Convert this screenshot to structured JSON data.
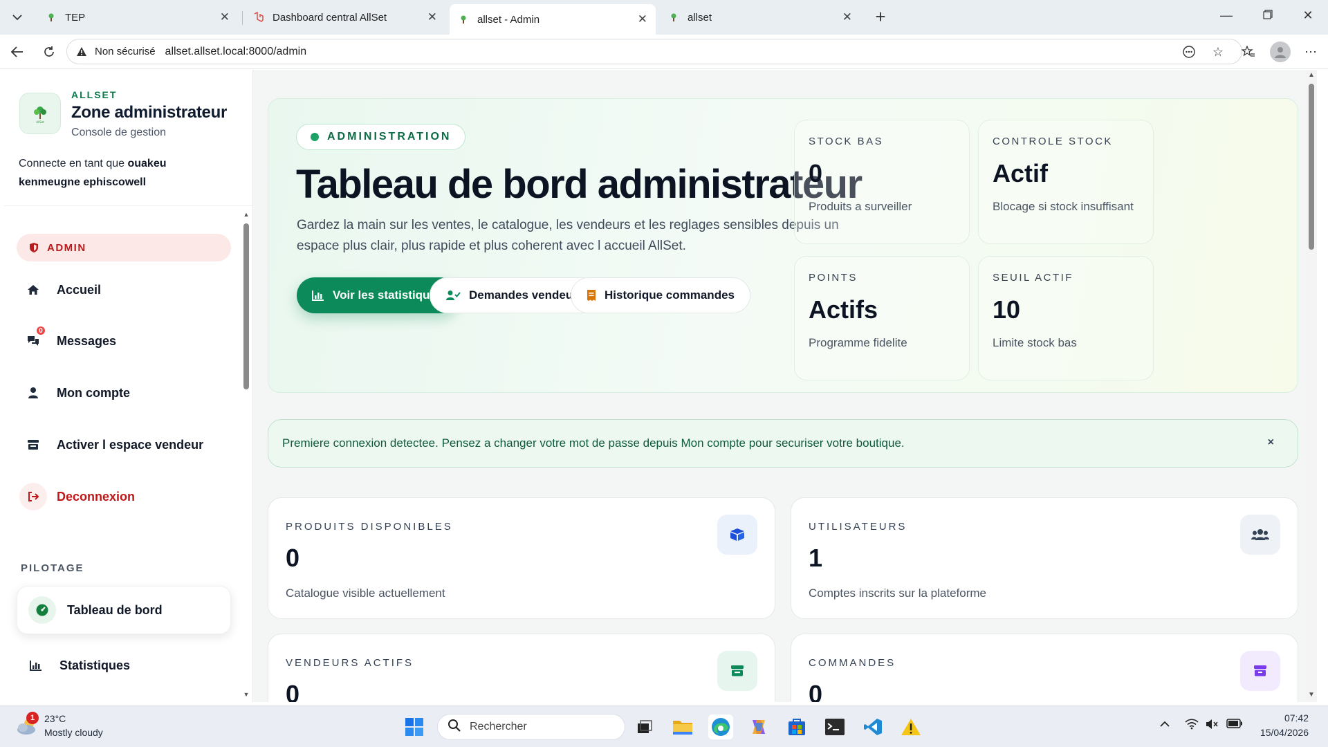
{
  "browser": {
    "tabs": [
      {
        "title": "TEP"
      },
      {
        "title": "Dashboard central AllSet"
      },
      {
        "title": "allset - Admin"
      },
      {
        "title": "allset"
      }
    ],
    "security_label": "Non sécurisé",
    "url": "allset.allset.local:8000/admin"
  },
  "sidebar": {
    "brand_tag": "ALLSET",
    "brand_title": "Zone administrateur",
    "brand_subtitle": "Console de gestion",
    "connected_prefix": "Connecte en tant que",
    "connected_user": "ouakeu kenmeugne ephiscowell",
    "role_label": "ADMIN",
    "nav": [
      {
        "label": "Accueil",
        "icon": "home-icon"
      },
      {
        "label": "Messages",
        "icon": "chat-icon",
        "badge": "0"
      },
      {
        "label": "Mon compte",
        "icon": "user-icon"
      },
      {
        "label": "Activer l espace vendeur",
        "icon": "store-icon"
      },
      {
        "label": "Deconnexion",
        "icon": "logout-icon"
      }
    ],
    "section_label": "PILOTAGE",
    "pilotage": [
      {
        "label": "Tableau de bord",
        "icon": "gauge-icon",
        "active": true
      },
      {
        "label": "Statistiques",
        "icon": "bar-chart-icon"
      }
    ]
  },
  "hero": {
    "pill": "ADMINISTRATION",
    "title": "Tableau de bord administrateur",
    "description": "Gardez la main sur les ventes, le catalogue, les vendeurs et les reglages sensibles depuis un espace plus clair, plus rapide et plus coherent avec l accueil AllSet.",
    "buttons": [
      {
        "label": "Voir les statistiques",
        "icon": "bar-chart-icon"
      },
      {
        "label": "Demandes vendeurs",
        "icon": "user-check-icon"
      },
      {
        "label": "Historique commandes",
        "icon": "receipt-icon"
      }
    ],
    "stats": [
      {
        "key": "STOCK BAS",
        "value": "0",
        "desc": "Produits a surveiller"
      },
      {
        "key": "CONTROLE STOCK",
        "value": "Actif",
        "desc": "Blocage si stock insuffisant"
      },
      {
        "key": "POINTS",
        "value": "Actifs",
        "desc": "Programme fidelite"
      },
      {
        "key": "SEUIL ACTIF",
        "value": "10",
        "desc": "Limite stock bas"
      }
    ]
  },
  "alert": {
    "text": "Premiere connexion detectee. Pensez a changer votre mot de passe depuis Mon compte pour securiser votre boutique.",
    "close": "×"
  },
  "cards": [
    {
      "key": "PRODUITS DISPONIBLES",
      "value": "0",
      "desc": "Catalogue visible actuellement",
      "icon": "box-icon",
      "accent": "#1d4ed8"
    },
    {
      "key": "UTILISATEURS",
      "value": "1",
      "desc": "Comptes inscrits sur la plateforme",
      "icon": "users-icon",
      "accent": "#334155"
    },
    {
      "key": "VENDEURS ACTIFS",
      "value": "0",
      "desc": "",
      "icon": "shop-icon",
      "accent": "#0d8a5a"
    },
    {
      "key": "COMMANDES",
      "value": "0",
      "desc": "",
      "icon": "archive-icon",
      "accent": "#7c3aed"
    }
  ],
  "taskbar": {
    "weather_temp": "23°C",
    "weather_cond": "Mostly cloudy",
    "weather_badge": "1",
    "search_label": "Rechercher",
    "time": "07:42",
    "date": "15/04/2026"
  },
  "colors": {
    "brand_green": "#0d8a5a",
    "danger": "#c01818",
    "badge_red": "#ef4444"
  }
}
